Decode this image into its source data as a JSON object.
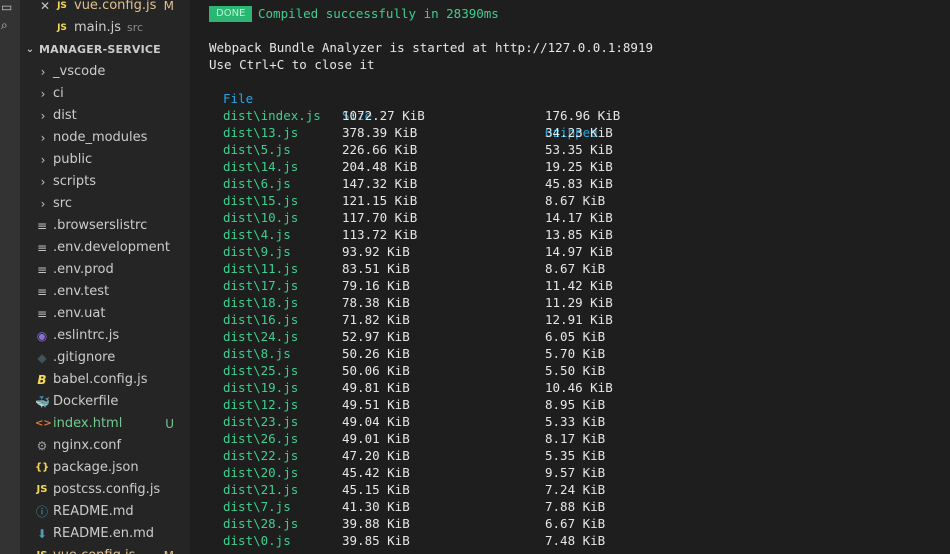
{
  "sidebar": {
    "open_editor": {
      "name": "vue.config.js",
      "badge": "M",
      "close": "✕"
    },
    "open_editor_2": {
      "name": "main.js",
      "suffix": "src"
    },
    "section_title": "MANAGER-SERVICE",
    "items": [
      {
        "label": "_vscode",
        "icon": "chevron-right",
        "kind": "folder"
      },
      {
        "label": "ci",
        "icon": "chevron-right",
        "kind": "folder"
      },
      {
        "label": "dist",
        "icon": "chevron-right",
        "kind": "folder"
      },
      {
        "label": "node_modules",
        "icon": "chevron-right",
        "kind": "folder"
      },
      {
        "label": "public",
        "icon": "chevron-right",
        "kind": "folder"
      },
      {
        "label": "scripts",
        "icon": "chevron-right",
        "kind": "folder"
      },
      {
        "label": "src",
        "icon": "chevron-right",
        "kind": "folder"
      },
      {
        "label": ".browserslistrc",
        "icon": "lines",
        "kind": "file"
      },
      {
        "label": ".env.development",
        "icon": "lines",
        "kind": "file"
      },
      {
        "label": ".env.prod",
        "icon": "lines",
        "kind": "file"
      },
      {
        "label": ".env.test",
        "icon": "lines",
        "kind": "file"
      },
      {
        "label": ".env.uat",
        "icon": "lines",
        "kind": "file"
      },
      {
        "label": ".eslintrc.js",
        "icon": "eslint",
        "kind": "file"
      },
      {
        "label": ".gitignore",
        "icon": "git",
        "kind": "file"
      },
      {
        "label": "babel.config.js",
        "icon": "babel",
        "kind": "file"
      },
      {
        "label": "Dockerfile",
        "icon": "docker",
        "kind": "file"
      },
      {
        "label": "index.html",
        "icon": "html",
        "kind": "file",
        "badge": "U"
      },
      {
        "label": "nginx.conf",
        "icon": "gear",
        "kind": "file"
      },
      {
        "label": "package.json",
        "icon": "braces",
        "kind": "file"
      },
      {
        "label": "postcss.config.js",
        "icon": "js",
        "kind": "file"
      },
      {
        "label": "README.md",
        "icon": "info",
        "kind": "file"
      },
      {
        "label": "README.en.md",
        "icon": "download",
        "kind": "file"
      },
      {
        "label": "vue.config.js",
        "icon": "js",
        "kind": "file",
        "badge": "M"
      }
    ],
    "icon_glyphs": {
      "chevron-right": "›",
      "lines": "≡",
      "eslint": "◉",
      "git": "◆",
      "babel": "B",
      "docker": "🐳",
      "html": "<>",
      "gear": "⚙",
      "braces": "{}",
      "js": "JS",
      "info": "ⓘ",
      "download": "⬇"
    },
    "icon_colors": {
      "chevron-right": "#c5c5c5",
      "lines": "#c5c5c5",
      "eslint": "#8c6fd6",
      "git": "#41535b",
      "babel": "#f5da55",
      "docker": "#1f8ad1",
      "html": "#e37933",
      "gear": "#a0a0a0",
      "braces": "#f5da55",
      "js": "#f5da55",
      "info": "#519aba",
      "download": "#519aba"
    },
    "colors": {
      "untracked": "#73c991",
      "modified": "#e2c08d"
    }
  },
  "terminal": {
    "done_label": "DONE",
    "compiled_text": "Compiled successfully in 28390ms",
    "line1": "Webpack Bundle Analyzer is started at http://127.0.0.1:8919",
    "line2": "Use Ctrl+C to close it",
    "headers": {
      "file": "File",
      "size": "Size",
      "gzipped": "Gzipped"
    },
    "rows": [
      {
        "file": "dist\\index.js",
        "size": "1072.27 KiB",
        "gz": "176.96 KiB"
      },
      {
        "file": "dist\\13.js",
        "size": "378.39 KiB",
        "gz": "34.23 KiB"
      },
      {
        "file": "dist\\5.js",
        "size": "226.66 KiB",
        "gz": "53.35 KiB"
      },
      {
        "file": "dist\\14.js",
        "size": "204.48 KiB",
        "gz": "19.25 KiB"
      },
      {
        "file": "dist\\6.js",
        "size": "147.32 KiB",
        "gz": "45.83 KiB"
      },
      {
        "file": "dist\\15.js",
        "size": "121.15 KiB",
        "gz": "8.67 KiB"
      },
      {
        "file": "dist\\10.js",
        "size": "117.70 KiB",
        "gz": "14.17 KiB"
      },
      {
        "file": "dist\\4.js",
        "size": "113.72 KiB",
        "gz": "13.85 KiB"
      },
      {
        "file": "dist\\9.js",
        "size": "93.92 KiB",
        "gz": "14.97 KiB"
      },
      {
        "file": "dist\\11.js",
        "size": "83.51 KiB",
        "gz": "8.67 KiB"
      },
      {
        "file": "dist\\17.js",
        "size": "79.16 KiB",
        "gz": "11.42 KiB"
      },
      {
        "file": "dist\\18.js",
        "size": "78.38 KiB",
        "gz": "11.29 KiB"
      },
      {
        "file": "dist\\16.js",
        "size": "71.82 KiB",
        "gz": "12.91 KiB"
      },
      {
        "file": "dist\\24.js",
        "size": "52.97 KiB",
        "gz": "6.05 KiB"
      },
      {
        "file": "dist\\8.js",
        "size": "50.26 KiB",
        "gz": "5.70 KiB"
      },
      {
        "file": "dist\\25.js",
        "size": "50.06 KiB",
        "gz": "5.50 KiB"
      },
      {
        "file": "dist\\19.js",
        "size": "49.81 KiB",
        "gz": "10.46 KiB"
      },
      {
        "file": "dist\\12.js",
        "size": "49.51 KiB",
        "gz": "8.95 KiB"
      },
      {
        "file": "dist\\23.js",
        "size": "49.04 KiB",
        "gz": "5.33 KiB"
      },
      {
        "file": "dist\\26.js",
        "size": "49.01 KiB",
        "gz": "8.17 KiB"
      },
      {
        "file": "dist\\22.js",
        "size": "47.20 KiB",
        "gz": "5.35 KiB"
      },
      {
        "file": "dist\\20.js",
        "size": "45.42 KiB",
        "gz": "9.57 KiB"
      },
      {
        "file": "dist\\21.js",
        "size": "45.15 KiB",
        "gz": "7.24 KiB"
      },
      {
        "file": "dist\\7.js",
        "size": "41.30 KiB",
        "gz": "7.88 KiB"
      },
      {
        "file": "dist\\28.js",
        "size": "39.88 KiB",
        "gz": "6.67 KiB"
      },
      {
        "file": "dist\\0.js",
        "size": "39.85 KiB",
        "gz": "7.48 KiB"
      }
    ]
  }
}
